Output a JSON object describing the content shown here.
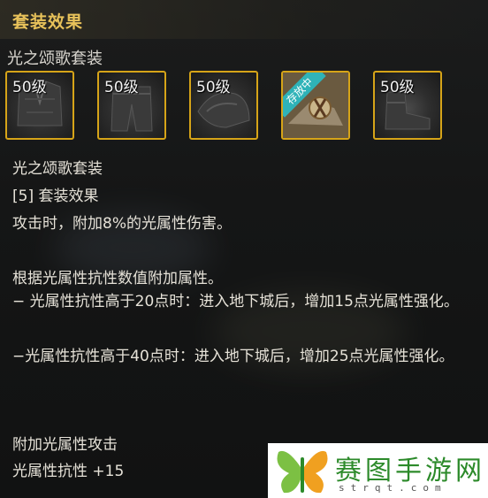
{
  "header": {
    "title": "套装效果"
  },
  "set": {
    "name": "光之颂歌套装"
  },
  "slots": [
    {
      "level": "50级",
      "icon": "chest-armor-icon"
    },
    {
      "level": "50级",
      "icon": "leg-armor-icon"
    },
    {
      "level": "50级",
      "icon": "shoulder-armor-icon"
    },
    {
      "level": "",
      "icon": "accessory-icon",
      "badge": "存放中"
    },
    {
      "level": "50级",
      "icon": "boots-icon"
    }
  ],
  "details": {
    "set_name": "光之颂歌套装",
    "effect_heading": "[5] 套装效果",
    "effect_line": "攻击时，附加8%的光属性伤害。",
    "resist_intro": "根据光属性抗性数值附加属性。",
    "resist_20": "− 光属性抗性高于20点时：进入地下城后，增加15点光属性强化。",
    "resist_40": "−光属性抗性高于40点时：进入地下城后，增加25点光属性强化。",
    "attack_heading": "附加光属性攻击",
    "resist_bonus": "光属性抗性 +15"
  },
  "watermark": {
    "text": "赛图手游网",
    "domain": "strqt.com"
  },
  "colors": {
    "title": "#e8c25a",
    "border": "#d6a418",
    "badge": "#2fb3b8",
    "logo_green": "#2c8a2a",
    "logo_orange": "#f0a020"
  }
}
